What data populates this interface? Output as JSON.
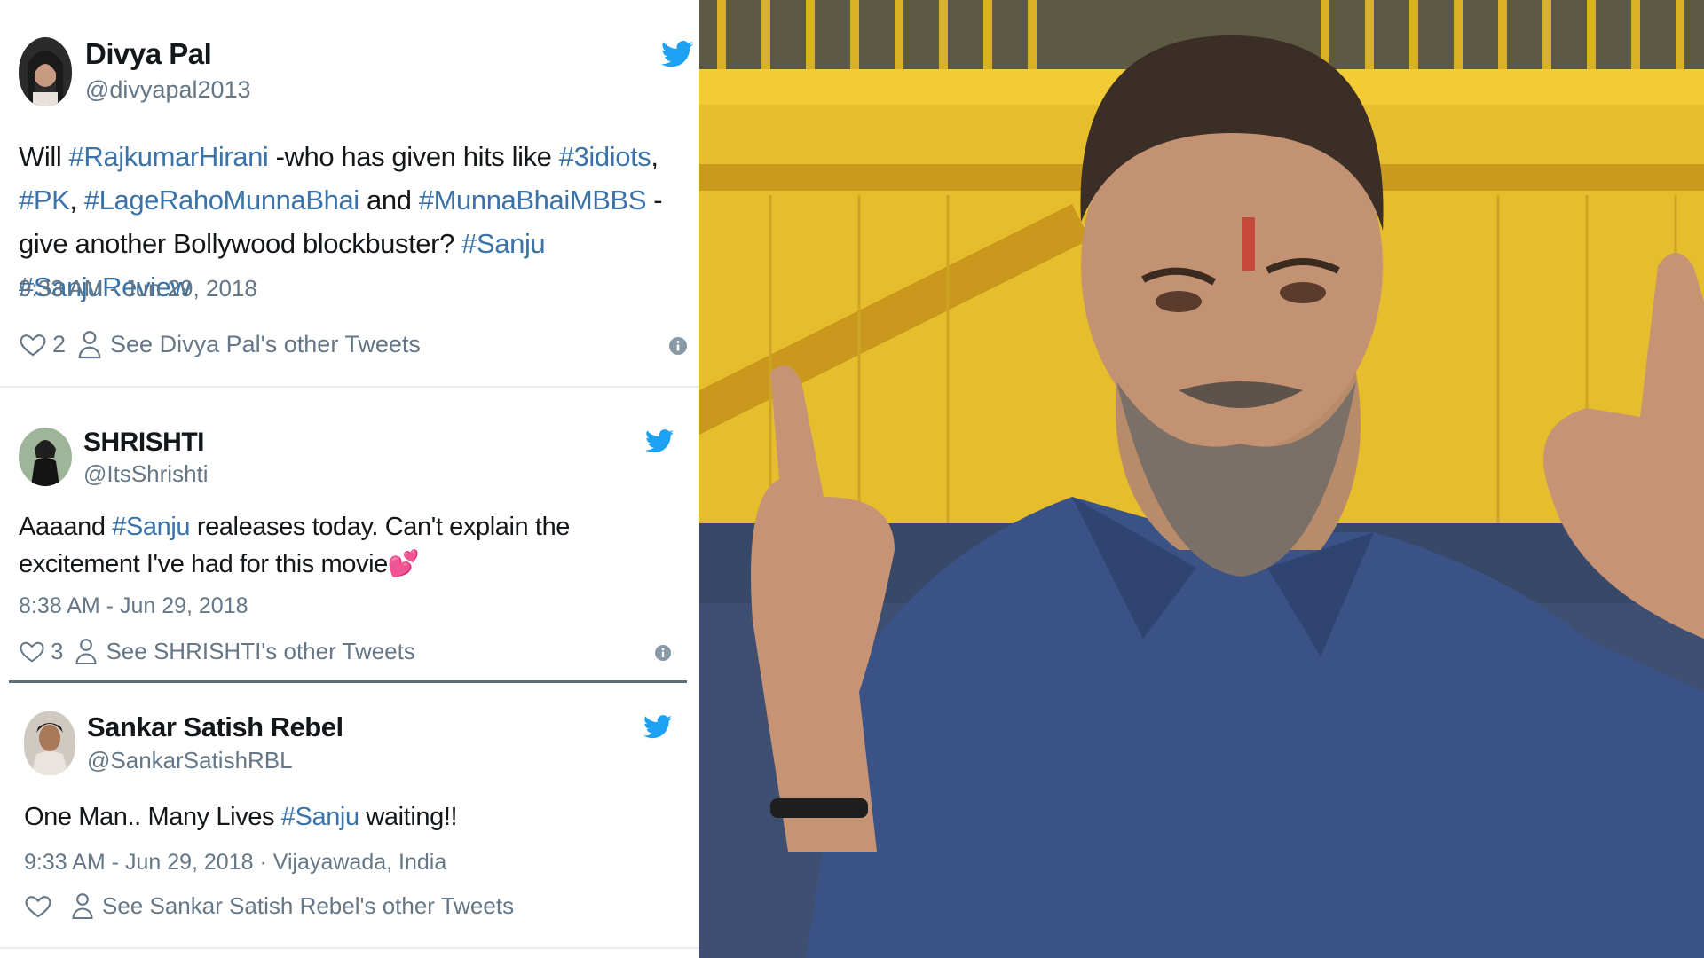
{
  "tweets": [
    {
      "name": "Divya Pal",
      "handle": "@divyapal2013",
      "text_parts": [
        {
          "t": "Will ",
          "tag": false
        },
        {
          "t": "#RajkumarHirani",
          "tag": true
        },
        {
          "t": " -who has given hits like ",
          "tag": false
        },
        {
          "t": "#3idiots",
          "tag": true
        },
        {
          "t": ", ",
          "tag": false
        },
        {
          "t": "#PK",
          "tag": true
        },
        {
          "t": ", ",
          "tag": false
        },
        {
          "t": "#LageRahoMunnaBhai",
          "tag": true
        },
        {
          "t": " and ",
          "tag": false
        },
        {
          "t": "#MunnaBhaiMBBS",
          "tag": true
        },
        {
          "t": " - give another Bollywood blockbuster? ",
          "tag": false
        },
        {
          "t": "#Sanju",
          "tag": true
        },
        {
          "t": " ",
          "tag": false
        },
        {
          "t": "#SanjuReview",
          "tag": true
        }
      ],
      "timestamp": "9:33 AM - Jun 29, 2018",
      "likes": "2",
      "other_tweets": "See Divya Pal's other Tweets"
    },
    {
      "name": "SHRISHTI",
      "handle": "@ItsShrishti",
      "text_parts": [
        {
          "t": "Aaaand ",
          "tag": false
        },
        {
          "t": "#Sanju",
          "tag": true
        },
        {
          "t": " realeases today. Can't explain the excitement I've had for this movie",
          "tag": false
        },
        {
          "t": "💕",
          "tag": false
        }
      ],
      "timestamp": "8:38 AM - Jun 29, 2018",
      "likes": "3",
      "other_tweets": "See SHRISHTI's other Tweets"
    },
    {
      "name": "Sankar Satish Rebel",
      "handle": "@SankarSatishRBL",
      "text_parts": [
        {
          "t": "One Man.. Many Lives ",
          "tag": false
        },
        {
          "t": "#Sanju",
          "tag": true
        },
        {
          "t": " waiting!!",
          "tag": false
        }
      ],
      "timestamp": "9:33 AM - Jun 29, 2018 · Vijayawada, India",
      "likes": "",
      "other_tweets": "See Sankar Satish Rebel's other Tweets"
    }
  ],
  "icons": {
    "twitter_bird": "twitter-bird-icon",
    "heart": "heart-icon",
    "person": "person-icon",
    "info": "info-icon"
  },
  "colors": {
    "hashtag": "#3b73a8",
    "twitter_blue": "#1da1f2",
    "meta_gray": "#657786"
  }
}
